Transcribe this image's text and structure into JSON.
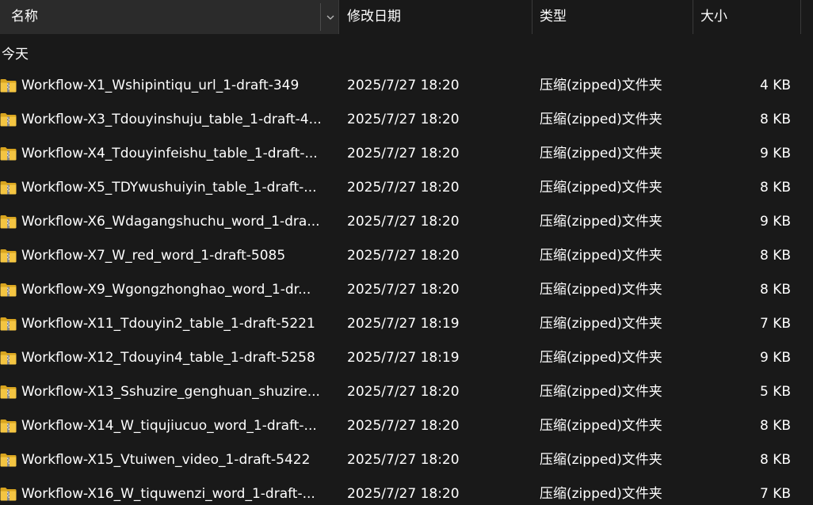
{
  "header": {
    "name_label": "名称",
    "date_label": "修改日期",
    "type_label": "类型",
    "size_label": "大小",
    "sort_indicator": "^"
  },
  "group": {
    "label": "今天"
  },
  "colors": {
    "background": "#191919",
    "header_active": "#2b2b2b",
    "text": "#ffffff",
    "folder_yellow": "#f4c542"
  },
  "files": [
    {
      "name": "Workflow-X1_Wshipintiqu_url_1-draft-349",
      "date": "2025/7/27 18:20",
      "type": "压缩(zipped)文件夹",
      "size": "4 KB",
      "icon": "zip-folder-icon"
    },
    {
      "name": "Workflow-X3_Tdouyinshuju_table_1-draft-4...",
      "date": "2025/7/27 18:20",
      "type": "压缩(zipped)文件夹",
      "size": "8 KB",
      "icon": "zip-folder-icon"
    },
    {
      "name": "Workflow-X4_Tdouyinfeishu_table_1-draft-...",
      "date": "2025/7/27 18:20",
      "type": "压缩(zipped)文件夹",
      "size": "9 KB",
      "icon": "zip-folder-icon"
    },
    {
      "name": "Workflow-X5_TDYwushuiyin_table_1-draft-...",
      "date": "2025/7/27 18:20",
      "type": "压缩(zipped)文件夹",
      "size": "8 KB",
      "icon": "zip-folder-icon"
    },
    {
      "name": "Workflow-X6_Wdagangshuchu_word_1-dra...",
      "date": "2025/7/27 18:20",
      "type": "压缩(zipped)文件夹",
      "size": "9 KB",
      "icon": "zip-folder-icon"
    },
    {
      "name": "Workflow-X7_W_red_word_1-draft-5085",
      "date": "2025/7/27 18:20",
      "type": "压缩(zipped)文件夹",
      "size": "8 KB",
      "icon": "zip-folder-icon"
    },
    {
      "name": "Workflow-X9_Wgongzhonghao_word_1-dr...",
      "date": "2025/7/27 18:20",
      "type": "压缩(zipped)文件夹",
      "size": "8 KB",
      "icon": "zip-folder-icon"
    },
    {
      "name": "Workflow-X11_Tdouyin2_table_1-draft-5221",
      "date": "2025/7/27 18:19",
      "type": "压缩(zipped)文件夹",
      "size": "7 KB",
      "icon": "zip-folder-icon"
    },
    {
      "name": "Workflow-X12_Tdouyin4_table_1-draft-5258",
      "date": "2025/7/27 18:19",
      "type": "压缩(zipped)文件夹",
      "size": "9 KB",
      "icon": "zip-folder-icon"
    },
    {
      "name": "Workflow-X13_Sshuzire_genghuan_shuzire...",
      "date": "2025/7/27 18:20",
      "type": "压缩(zipped)文件夹",
      "size": "5 KB",
      "icon": "zip-folder-icon"
    },
    {
      "name": "Workflow-X14_W_tiqujiucuo_word_1-draft-...",
      "date": "2025/7/27 18:20",
      "type": "压缩(zipped)文件夹",
      "size": "8 KB",
      "icon": "zip-folder-icon"
    },
    {
      "name": "Workflow-X15_Vtuiwen_video_1-draft-5422",
      "date": "2025/7/27 18:20",
      "type": "压缩(zipped)文件夹",
      "size": "8 KB",
      "icon": "zip-folder-icon"
    },
    {
      "name": "Workflow-X16_W_tiquwenzi_word_1-draft-...",
      "date": "2025/7/27 18:20",
      "type": "压缩(zipped)文件夹",
      "size": "7 KB",
      "icon": "zip-folder-icon"
    }
  ]
}
